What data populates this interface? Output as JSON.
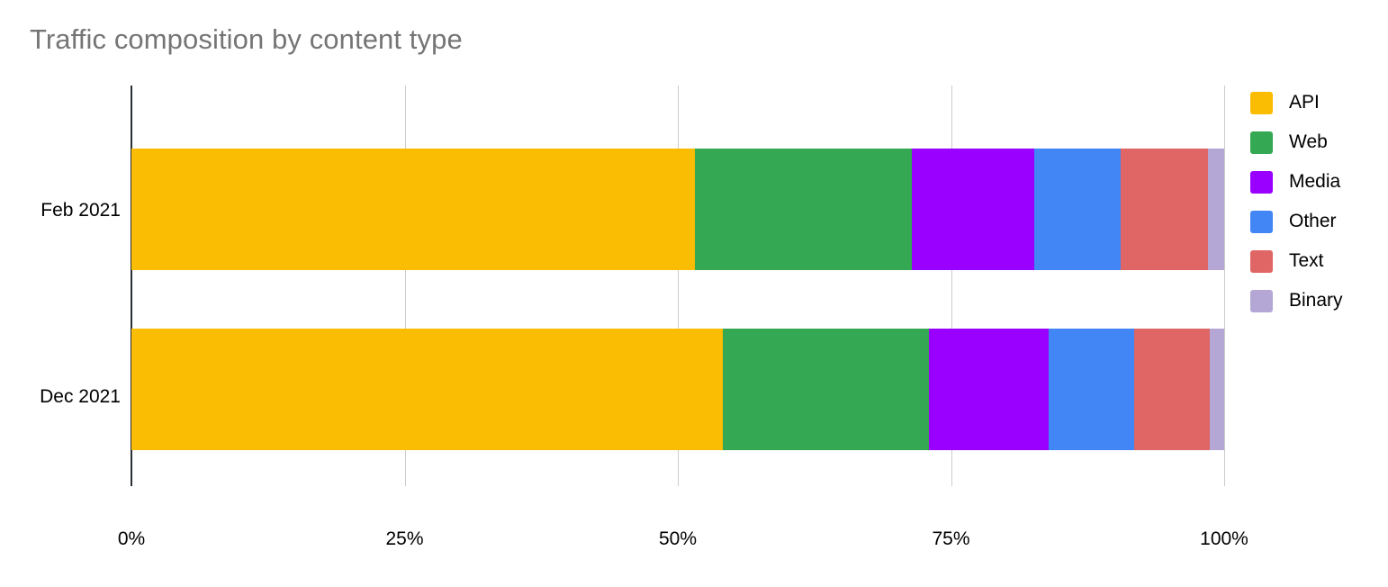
{
  "chart_data": {
    "type": "bar",
    "orientation": "horizontal",
    "stacked": true,
    "normalized": true,
    "title": "Traffic composition by content type",
    "xlabel": "",
    "ylabel": "",
    "categories": [
      "Feb 2021",
      "Dec 2021"
    ],
    "series": [
      {
        "name": "API",
        "color": "#fbbc04",
        "values": [
          51.6,
          54.1
        ]
      },
      {
        "name": "Web",
        "color": "#34a853",
        "values": [
          19.8,
          18.9
        ]
      },
      {
        "name": "Media",
        "color": "#9900ff",
        "values": [
          11.2,
          10.9
        ]
      },
      {
        "name": "Other",
        "color": "#4285f4",
        "values": [
          7.9,
          7.9
        ]
      },
      {
        "name": "Text",
        "color": "#e06666",
        "values": [
          8.0,
          6.9
        ]
      },
      {
        "name": "Binary",
        "color": "#b4a7d6",
        "values": [
          1.5,
          1.3
        ]
      }
    ],
    "xticks": [
      "0%",
      "25%",
      "50%",
      "75%",
      "100%"
    ],
    "xtick_values": [
      0,
      25,
      50,
      75,
      100
    ],
    "xlim": [
      0,
      100
    ],
    "grid": true,
    "legend_position": "right"
  },
  "legend": {
    "items": [
      {
        "label": "API",
        "color": "#fbbc04"
      },
      {
        "label": "Web",
        "color": "#34a853"
      },
      {
        "label": "Media",
        "color": "#9900ff"
      },
      {
        "label": "Other",
        "color": "#4285f4"
      },
      {
        "label": "Text",
        "color": "#e06666"
      },
      {
        "label": "Binary",
        "color": "#b4a7d6"
      }
    ]
  },
  "colors": {
    "title": "#757575",
    "axis": "#2a2f33",
    "grid": "#cccccc",
    "text": "#000000",
    "background": "#ffffff"
  }
}
